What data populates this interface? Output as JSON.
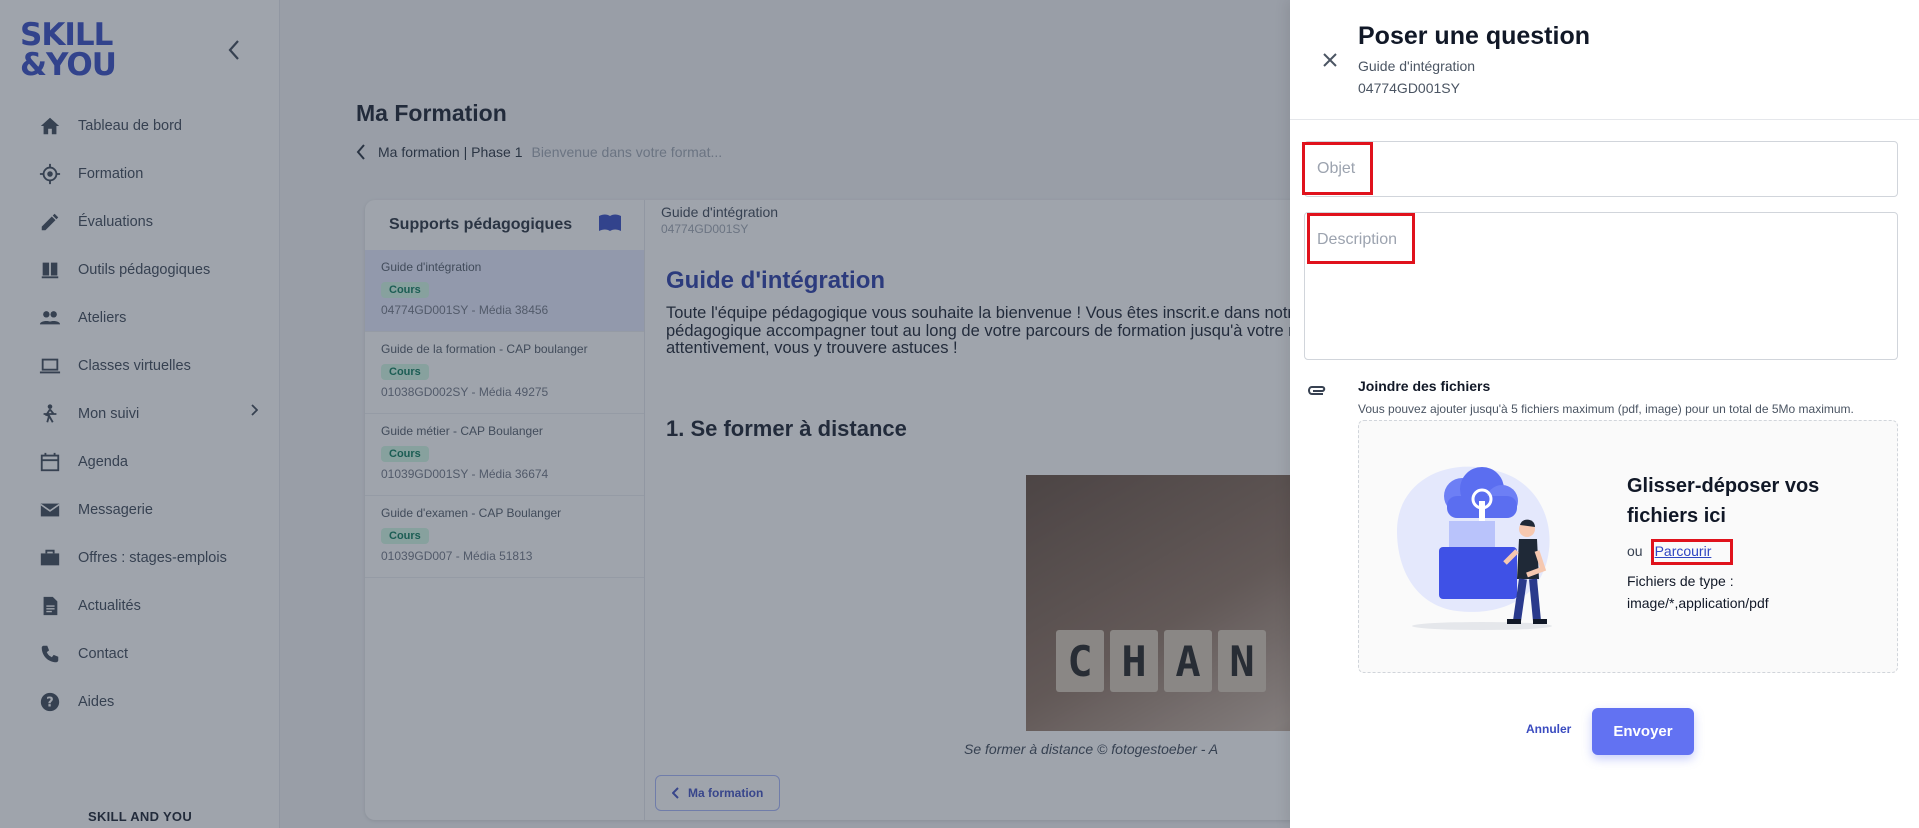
{
  "brand": {
    "logo_line1": "SKILL",
    "logo_line2": "&YOU",
    "footer": "SKILL AND YOU"
  },
  "sidebar": {
    "items": [
      {
        "label": "Tableau de bord",
        "icon": "home-icon"
      },
      {
        "label": "Formation",
        "icon": "target-icon"
      },
      {
        "label": "Évaluations",
        "icon": "pencil-icon"
      },
      {
        "label": "Outils pédagogiques",
        "icon": "book-hand-icon"
      },
      {
        "label": "Ateliers",
        "icon": "group-icon"
      },
      {
        "label": "Classes virtuelles",
        "icon": "laptop-icon"
      },
      {
        "label": "Mon suivi",
        "icon": "person-walk-icon"
      },
      {
        "label": "Agenda",
        "icon": "calendar-icon"
      },
      {
        "label": "Messagerie",
        "icon": "mail-icon"
      },
      {
        "label": "Offres : stages-emplois",
        "icon": "briefcase-icon"
      },
      {
        "label": "Actualités",
        "icon": "article-icon"
      },
      {
        "label": "Contact",
        "icon": "phone-icon"
      },
      {
        "label": "Aides",
        "icon": "help-icon"
      }
    ]
  },
  "main": {
    "title": "Ma Formation",
    "breadcrumb_current": "Ma formation | Phase 1",
    "breadcrumb_sub": "Bienvenue dans votre format..."
  },
  "supports": {
    "title": "Supports pédagogiques",
    "items": [
      {
        "title": "Guide d'intégration",
        "badge": "Cours",
        "meta": "04774GD001SY - Média 38456"
      },
      {
        "title": "Guide de la formation - CAP boulanger",
        "badge": "Cours",
        "meta": "01038GD002SY - Média 49275"
      },
      {
        "title": "Guide métier - CAP Boulanger",
        "badge": "Cours",
        "meta": "01039GD001SY - Média 36674"
      },
      {
        "title": "Guide d'examen - CAP Boulanger",
        "badge": "Cours",
        "meta": "01039GD007 - Média 51813"
      }
    ]
  },
  "content": {
    "head_title": "Guide d'intégration",
    "head_code": "04774GD001SY",
    "doc_title": "Guide d'intégration",
    "paragraph": "Toute l'équipe pédagogique vous souhaite la bienvenue ! Vous êtes inscrit.e dans notre distance avec nous. Nous vous remercions de votre confiance. Nos équipes pédagogique accompagner tout au long de votre parcours de formation jusqu'à votre réussite. Ce guide de bien appréhender et organiser votre formation. Lisez-le attentivement, vous y trouvere astuces !",
    "section": "1. Se former à distance",
    "photo_letters": [
      "C",
      "H",
      "A",
      "N"
    ],
    "caption": "Se former à distance © fotogestoeber - A",
    "back_button": "Ma formation"
  },
  "drawer": {
    "title": "Poser une question",
    "subtitle": "Guide d'intégration",
    "code": "04774GD001SY",
    "objet_placeholder": "Objet",
    "description_placeholder": "Description",
    "attach_title": "Joindre des fichiers",
    "attach_desc": "Vous pouvez ajouter jusqu'à 5 fichiers maximum (pdf, image) pour un total de 5Mo maximum.",
    "drop_title": "Glisser-déposer vos fichiers ici",
    "or_label": "ou",
    "browse": "Parcourir",
    "types_label": "Fichiers de type :",
    "types": "image/*,application/pdf",
    "cancel": "Annuler",
    "send": "Envoyer"
  },
  "colors": {
    "brand": "#2f46c2",
    "accent": "#6272f2",
    "highlight": "#e0121c"
  }
}
